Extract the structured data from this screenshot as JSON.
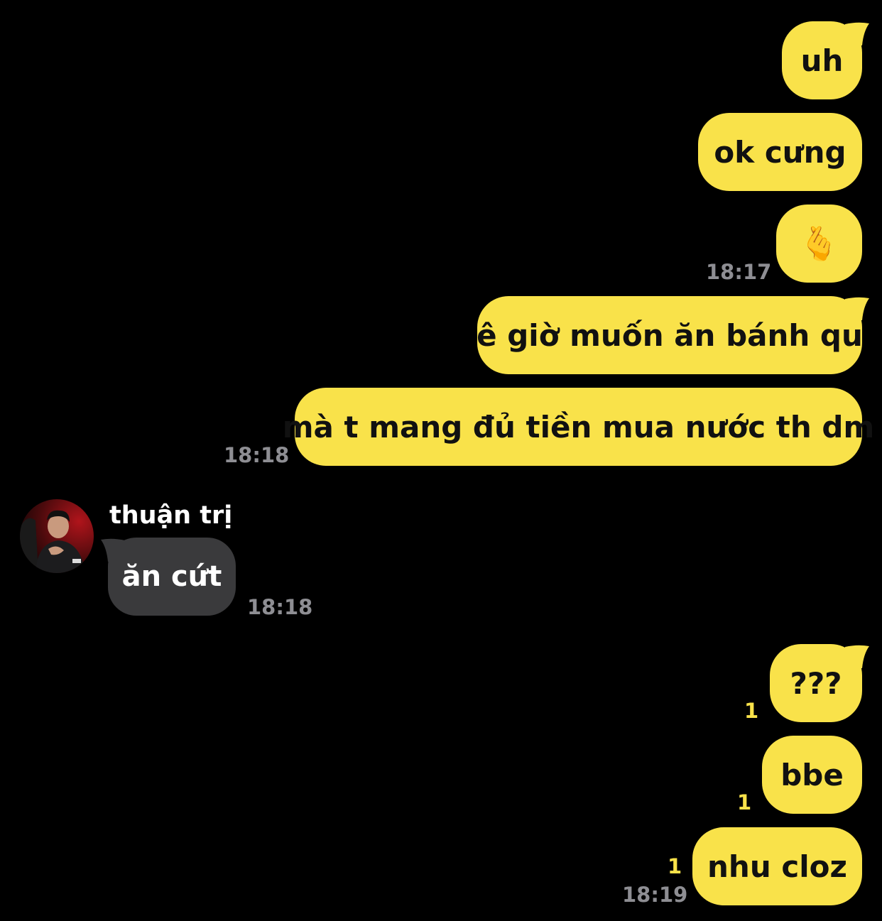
{
  "colors": {
    "background": "#000000",
    "outgoing_bubble": "#F9E24A",
    "incoming_bubble": "#3A3A3C",
    "timestamp": "#8E8E93",
    "unread_count": "#F9E24A"
  },
  "messages": [
    {
      "direction": "outgoing",
      "text": "uh"
    },
    {
      "direction": "outgoing",
      "text": "ok cưng"
    },
    {
      "direction": "outgoing",
      "text": "🫰",
      "time": "18:17"
    },
    {
      "direction": "outgoing",
      "text": "ê giờ muốn ăn bánh qu"
    },
    {
      "direction": "outgoing",
      "text": "mà t mang đủ tiền mua nước th dm",
      "time": "18:18"
    },
    {
      "direction": "incoming",
      "sender": "thuận trị",
      "text": "ăn cứt",
      "time": "18:18"
    },
    {
      "direction": "outgoing",
      "text": "???",
      "unread": "1"
    },
    {
      "direction": "outgoing",
      "text": "bbe",
      "unread": "1"
    },
    {
      "direction": "outgoing",
      "text": "nhu cloz",
      "unread": "1",
      "time": "18:19"
    }
  ]
}
